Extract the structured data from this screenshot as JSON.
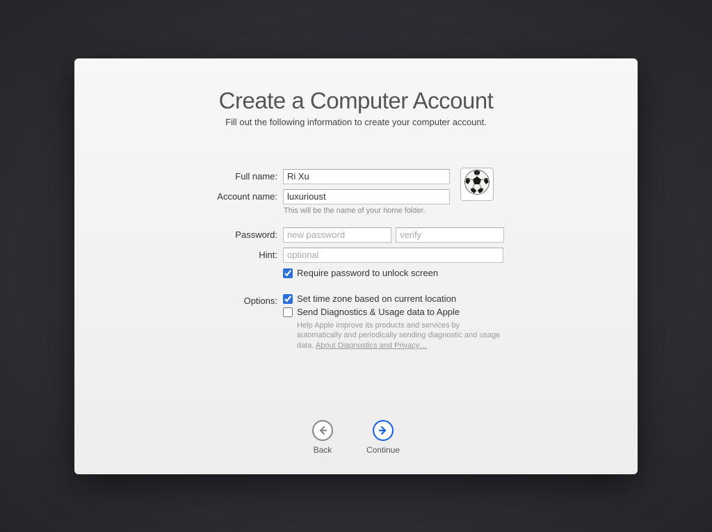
{
  "header": {
    "title": "Create a Computer Account",
    "subtitle": "Fill out the following information to create your computer account."
  },
  "labels": {
    "full_name": "Full name:",
    "account_name": "Account name:",
    "password": "Password:",
    "hint": "Hint:",
    "options": "Options:"
  },
  "fields": {
    "full_name_value": "Ri Xu",
    "account_name_value": "luxurioust",
    "account_name_help": "This will be the name of your home folder.",
    "password_placeholder": "new password",
    "verify_placeholder": "verify",
    "hint_placeholder": "optional"
  },
  "checkboxes": {
    "require_password": {
      "label": "Require password to unlock screen",
      "checked": true
    },
    "timezone": {
      "label": "Set time zone based on current location",
      "checked": true
    },
    "diagnostics": {
      "label": "Send Diagnostics & Usage data to Apple",
      "checked": false
    },
    "diagnostics_help": "Help Apple improve its products and services by automatically and periodically sending diagnostic and usage data. ",
    "diagnostics_link": "About Diagnostics and Privacy…"
  },
  "avatar": {
    "icon": "soccer-ball"
  },
  "nav": {
    "back": "Back",
    "continue": "Continue"
  }
}
